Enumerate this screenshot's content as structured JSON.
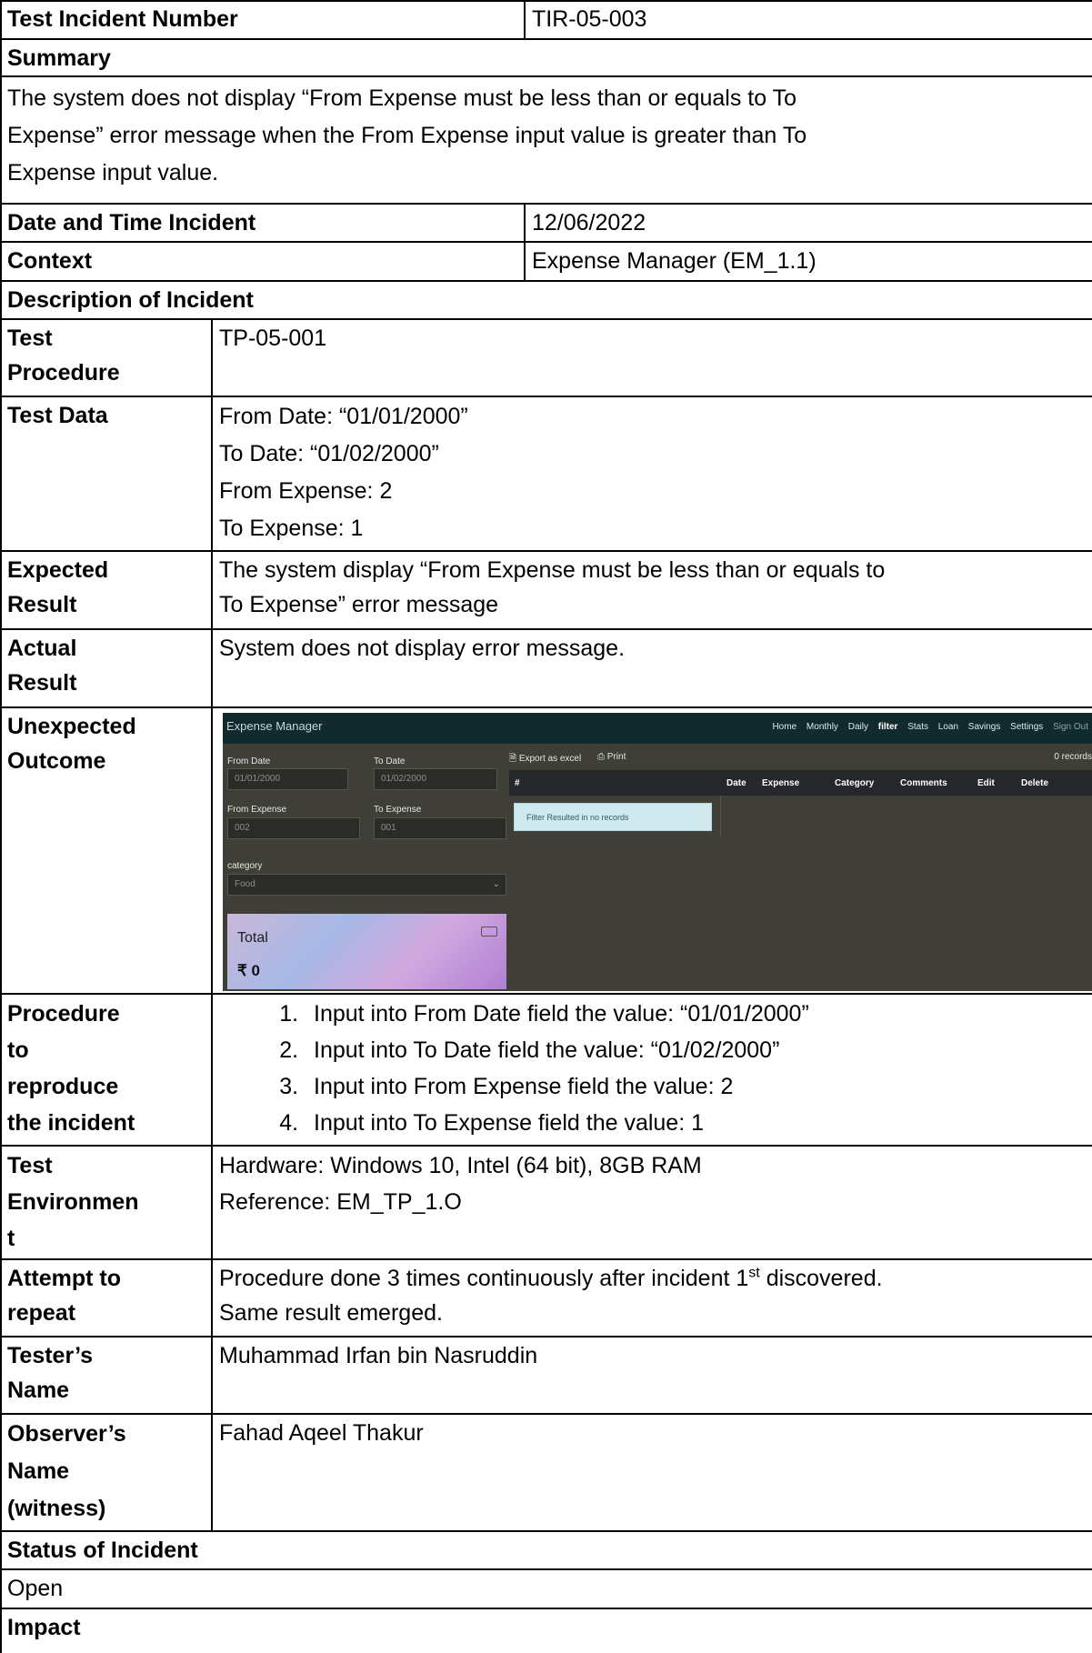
{
  "incident_number": {
    "label": "Test Incident Number",
    "value": "TIR-05-003"
  },
  "summary": {
    "label": "Summary",
    "lines": [
      "The system does not display “From Expense must be less than or equals to To",
      "Expense” error message when the From Expense input value is greater than To",
      "Expense input value."
    ]
  },
  "date_time": {
    "label": "Date and Time Incident",
    "value": "12/06/2022"
  },
  "context": {
    "label": "Context",
    "value": "Expense Manager (EM_1.1)"
  },
  "description_label": "Description of Incident",
  "test_procedure": {
    "label": [
      "Test",
      "Procedure"
    ],
    "value": "TP-05-001"
  },
  "test_data": {
    "label": "Test Data",
    "lines": [
      "From Date: “01/01/2000”",
      "To Date: “01/02/2000”",
      "From Expense: 2",
      "To Expense: 1"
    ]
  },
  "expected_result": {
    "label": [
      "Expected",
      "Result"
    ],
    "lines": [
      "The system display “From Expense must be less than or equals to",
      "To Expense” error message"
    ]
  },
  "actual_result": {
    "label": [
      "Actual",
      "Result"
    ],
    "value": "System does not display error message."
  },
  "unexpected_outcome": {
    "label": [
      "Unexpected",
      "Outcome"
    ],
    "screenshot": {
      "brand": "Expense Manager",
      "nav": [
        "Home",
        "Monthly",
        "Daily",
        "filter",
        "Stats",
        "Loan",
        "Savings",
        "Settings",
        "Sign Out"
      ],
      "active_nav": "filter",
      "from_date_label": "From Date",
      "from_date_value": "01/01/2000",
      "to_date_label": "To Date",
      "to_date_value": "01/02/2000",
      "from_expense_label": "From Expense",
      "from_expense_value": "002",
      "to_expense_label": "To Expense",
      "to_expense_value": "001",
      "category_label": "category",
      "category_value": "Food",
      "total_label": "Total",
      "total_value": "₹ 0",
      "export_label": "Export as excel",
      "print_label": "Print",
      "records": "0 records",
      "columns": [
        "#",
        "Date",
        "Expense",
        "Category",
        "Comments",
        "Edit",
        "Delete"
      ],
      "alert": "Filter Resulted in no records",
      "colors": {
        "navbar": "#112a2d",
        "background": "#3f3f38",
        "alert": "#cfe9ef"
      }
    }
  },
  "procedure": {
    "label": [
      "Procedure",
      "to",
      "reproduce",
      "the incident"
    ],
    "steps": [
      "Input into From Date field the value: “01/01/2000”",
      "Input into To Date field the value: “01/02/2000”",
      "Input into From Expense field the value: 2",
      "Input into To Expense field the value: 1"
    ]
  },
  "test_environment": {
    "label": [
      "Test",
      "Environmen",
      "t"
    ],
    "lines": [
      "Hardware: Windows 10, Intel (64 bit), 8GB RAM",
      "Reference: EM_TP_1.O"
    ]
  },
  "attempt": {
    "label": [
      "Attempt to",
      "repeat"
    ],
    "line1_a": "Procedure done 3 times continuously after incident 1",
    "line1_sup": "st",
    "line1_b": " discovered.",
    "line2": "Same result emerged."
  },
  "tester": {
    "label": [
      "Tester’s",
      "Name"
    ],
    "value": "Muhammad Irfan bin Nasruddin"
  },
  "observer": {
    "label": [
      "Observer’s",
      "Name",
      "(witness)"
    ],
    "value": "Fahad Aqeel Thakur"
  },
  "status": {
    "label": "Status of Incident",
    "value": "Open"
  },
  "impact": {
    "label": "Impact"
  }
}
